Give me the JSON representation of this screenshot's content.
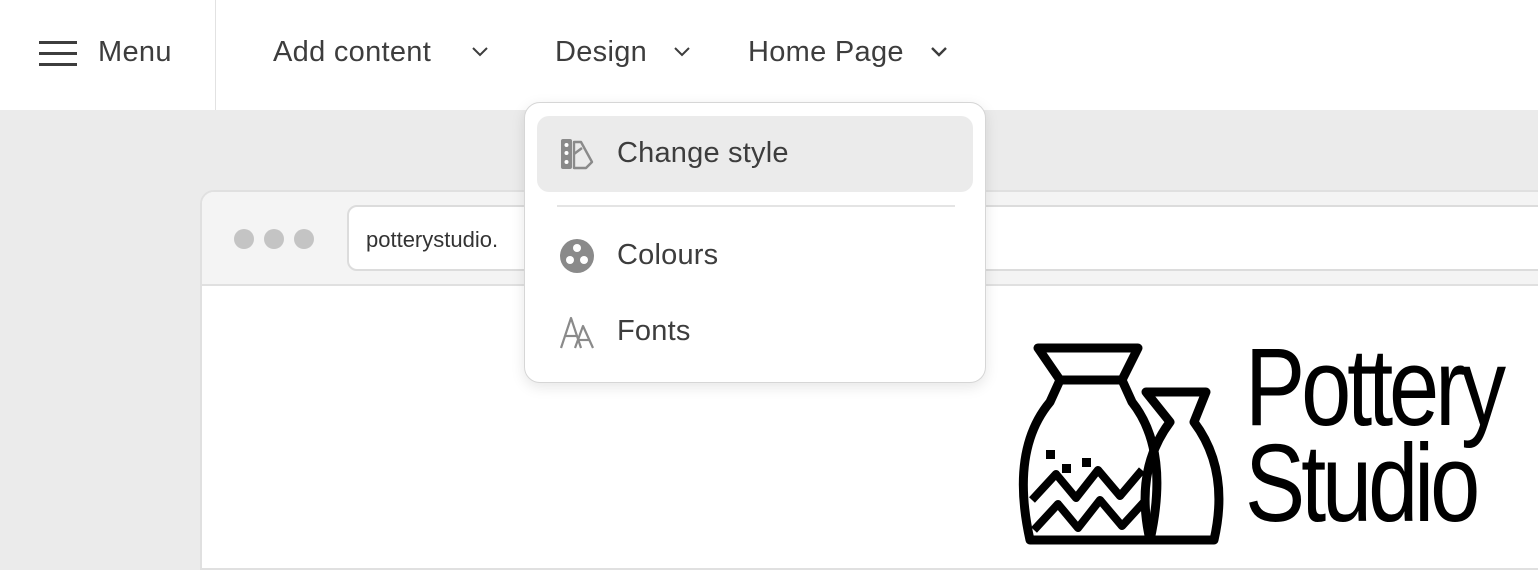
{
  "toolbar": {
    "menu_label": "Menu",
    "nav": [
      {
        "label": "Add content"
      },
      {
        "label": "Design"
      },
      {
        "label": "Home Page"
      }
    ]
  },
  "browser": {
    "url": "potterystudio."
  },
  "site_logo": {
    "text_line1": "Pottery",
    "text_line2": "Studio"
  },
  "design_dropdown": {
    "items": [
      {
        "label": "Change style",
        "icon": "swatch-icon",
        "active": true
      },
      {
        "label": "Colours",
        "icon": "palette-icon",
        "active": false
      },
      {
        "label": "Fonts",
        "icon": "fonts-icon",
        "active": false
      }
    ]
  },
  "colors": {
    "topbar_bg": "#ffffff",
    "canvas_bg": "#ebebeb",
    "text": "#3d3d3d",
    "icon": "#8a8a8a",
    "active_item_bg": "#ebebeb"
  }
}
